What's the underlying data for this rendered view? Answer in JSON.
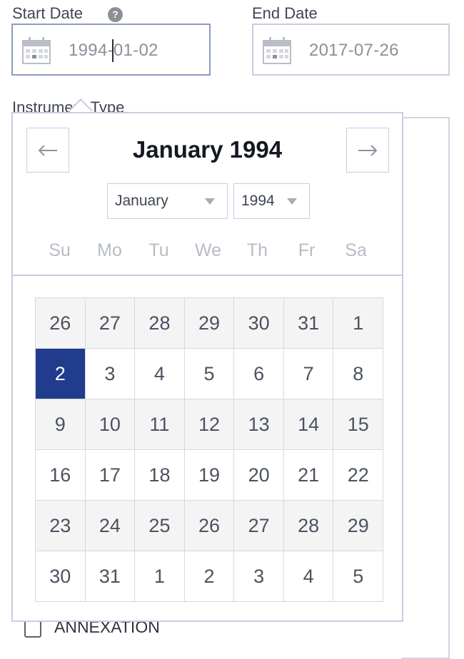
{
  "start_date": {
    "label": "Start Date",
    "help": "?",
    "value": "1994-01-02"
  },
  "end_date": {
    "label": "End Date",
    "value": "2017-07-26"
  },
  "instrument_type": {
    "label": "Instrument Type",
    "option_partial": "ANNEXATION"
  },
  "calendar": {
    "title": "January 1994",
    "month_select": "January",
    "year_select": "1994",
    "prev_icon": "arrow-left-icon",
    "next_icon": "arrow-right-icon",
    "weekdays": [
      "Su",
      "Mo",
      "Tu",
      "We",
      "Th",
      "Fr",
      "Sa"
    ],
    "weeks": [
      [
        "26",
        "27",
        "28",
        "29",
        "30",
        "31",
        "1"
      ],
      [
        "2",
        "3",
        "4",
        "5",
        "6",
        "7",
        "8"
      ],
      [
        "9",
        "10",
        "11",
        "12",
        "13",
        "14",
        "15"
      ],
      [
        "16",
        "17",
        "18",
        "19",
        "20",
        "21",
        "22"
      ],
      [
        "23",
        "24",
        "25",
        "26",
        "27",
        "28",
        "29"
      ],
      [
        "30",
        "31",
        "1",
        "2",
        "3",
        "4",
        "5"
      ]
    ],
    "selected_date": "2",
    "colors": {
      "selected": "#213b8d",
      "shaded_row": "#f4f4f5"
    }
  }
}
